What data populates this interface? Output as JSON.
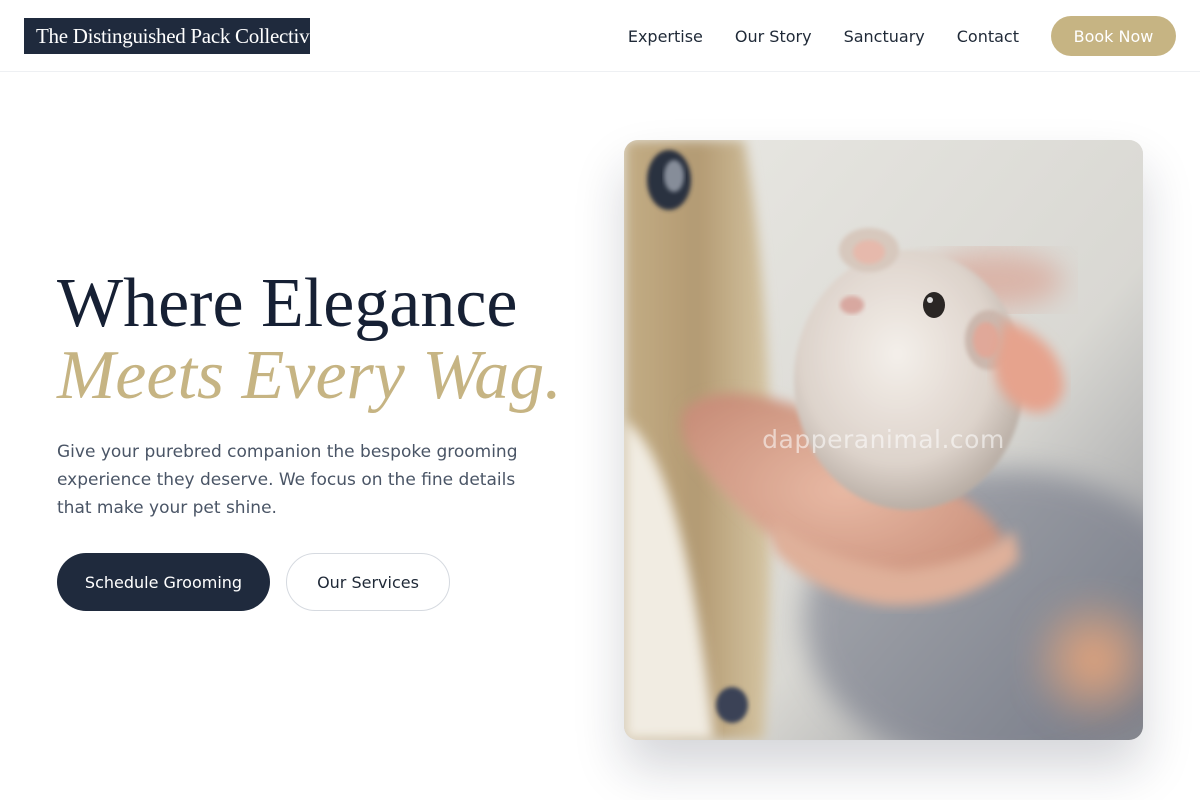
{
  "header": {
    "logo_text": "The Distinguished Pack Collective",
    "nav": [
      {
        "label": "Expertise"
      },
      {
        "label": "Our Story"
      },
      {
        "label": "Sanctuary"
      },
      {
        "label": "Contact"
      }
    ],
    "cta_label": "Book Now"
  },
  "hero": {
    "title_line1": "Where Elegance",
    "title_line2": "Meets Every Wag.",
    "description": "Give your purebred companion the bespoke grooming experience they deserve. We focus on the fine details that make your pet shine.",
    "primary_button": "Schedule Grooming",
    "secondary_button": "Our Services",
    "image": {
      "subject": "hamster-held-in-hand-photo",
      "watermark": "dapperanimal.com"
    }
  },
  "colors": {
    "navy": "#1f2a3d",
    "gold": "#c6b483",
    "text_muted": "#4a5566"
  }
}
